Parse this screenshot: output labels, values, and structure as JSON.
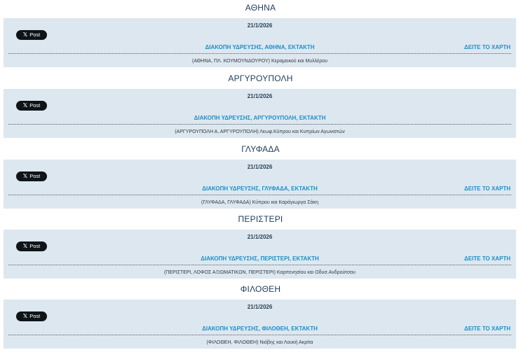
{
  "x_post_label": "Post",
  "map_link": "ΔΕΙΤΕ ΤΟ ΧΑΡΤΗ",
  "sections": [
    {
      "city": "ΑΘΗΝΑ",
      "date": "21/1/2026",
      "headline": "ΔΙΑΚΟΠΗ ΥΔΡΕΥΣΗΣ, ΑΘΗΝΑ, ΕΚΤΑΚΤΗ",
      "details": "(ΑΘΗΝΑ, ΠΛ. ΚΟΥΜΟΥΝΔΟΥΡΟΥ) Κεραμεικού και Μυλλέρου"
    },
    {
      "city": "ΑΡΓΥΡΟΥΠΟΛΗ",
      "date": "21/1/2026",
      "headline": "ΔΙΑΚΟΠΗ ΥΔΡΕΥΣΗΣ, ΑΡΓΥΡΟΥΠΟΛΗ, ΕΚΤΑΚΤΗ",
      "details": "(ΑΡΓΥΡΟΥΠΟΛΗ Α, ΑΡΓΥΡΟΥΠΟΛΗ) Λεωφ.Κύπρου και Κυπρίων Αγωνιστών"
    },
    {
      "city": "ΓΛΥΦΑΔΑ",
      "date": "21/1/2026",
      "headline": "ΔΙΑΚΟΠΗ ΥΔΡΕΥΣΗΣ, ΓΛΥΦΑΔΑ, ΕΚΤΑΚΤΗ",
      "details": "(ΓΛΥΦΑΔΑ, ΓΛΥΦΑΔΑ) Κύπρου και Καράγιωργα Σάκη"
    },
    {
      "city": "ΠΕΡΙΣΤΕΡΙ",
      "date": "21/1/2026",
      "headline": "ΔΙΑΚΟΠΗ ΥΔΡΕΥΣΗΣ, ΠΕΡΙΣΤΕΡΙ, ΕΚΤΑΚΤΗ",
      "details": "(ΠΕΡΙΣΤΕΡΙ, ΛΟΦΟΣ ΑΞΙΩΜΑΤΙΚΩΝ, ΠΕΡΙΣΤΕΡΙ) Καρπενησίου και Οδυσ.Ανδρούτσου"
    },
    {
      "city": "ΦΙΛΟΘΕΗ",
      "date": "21/1/2026",
      "headline": "ΔΙΑΚΟΠΗ ΥΔΡΕΥΣΗΣ, ΦΙΛΟΘΕΗ, ΕΚΤΑΚΤΗ",
      "details": "(ΦΙΛΟΘΕΗ, ΦΙΛΟΘΕΗ) Νιόβης και Λουκή Ακρίτα"
    }
  ],
  "colors": {
    "card_bg": "#dde7ef",
    "title": "#1f3b5c",
    "link": "#1d8fc7",
    "x_button": "#0f1419"
  },
  "icons": {
    "x_logo": "x-logo-icon"
  }
}
